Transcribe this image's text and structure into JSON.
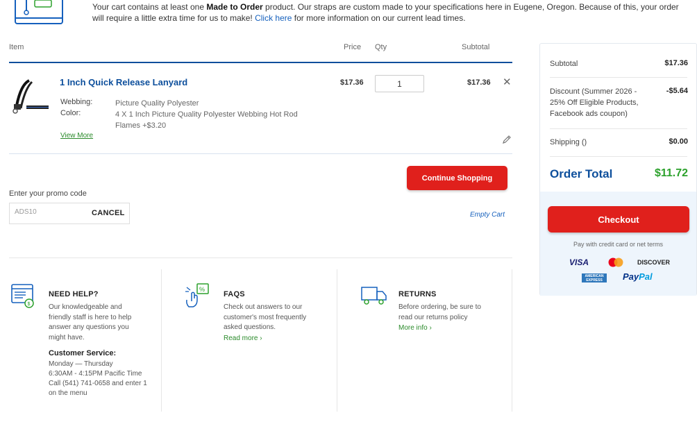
{
  "notice": {
    "text_pre": "Your cart contains at least one ",
    "text_bold": "Made to Order",
    "text_mid": " product. Our straps are custom made to your specifications here in Eugene, Oregon. Because of this, your order will require a little extra time for us to make! ",
    "link": "Click here",
    "text_post": " for more information on our current lead times."
  },
  "table_headers": {
    "item": "Item",
    "price": "Price",
    "qty": "Qty",
    "subtotal": "Subtotal"
  },
  "cart_item": {
    "name": "1 Inch Quick Release Lanyard",
    "options": [
      {
        "label": "Webbing:",
        "value": "Picture Quality Polyester"
      },
      {
        "label": "Color:",
        "value": "4 X 1 Inch Picture Quality Polyester Webbing Hot Rod Flames +$3.20"
      }
    ],
    "view_more": "View More",
    "price": "$17.36",
    "qty": "1",
    "subtotal": "$17.36"
  },
  "actions": {
    "continue_shopping": "Continue Shopping",
    "empty_cart": "Empty Cart"
  },
  "promo": {
    "label": "Enter your promo code",
    "value": "ADS10",
    "cancel": "CANCEL"
  },
  "help": {
    "need_help": {
      "title": "NEED HELP?",
      "text": "Our knowledgeable and friendly staff is here to help answer any questions you might have.",
      "cs_title": "Customer Service:",
      "cs_text_1": "Monday — Thursday",
      "cs_text_2": "6:30AM - 4:15PM Pacific Time",
      "cs_text_3": "Call (541) 741-0658 and enter 1 on the menu"
    },
    "faqs": {
      "title": "FAQS",
      "text": "Check out answers to our customer's most frequently asked questions.",
      "link": "Read more ›"
    },
    "returns": {
      "title": "RETURNS",
      "text": "Before ordering, be sure to read our returns policy",
      "link": "More info ›"
    }
  },
  "summary": {
    "subtotal_label": "Subtotal",
    "subtotal_value": "$17.36",
    "discount_label": "Discount (Summer 2026 - 25% Off Eligible Products, Facebook ads coupon)",
    "discount_value": "-$5.64",
    "shipping_label": "Shipping ()",
    "shipping_value": "$0.00",
    "total_label": "Order Total",
    "total_value": "$11.72",
    "checkout": "Checkout",
    "pay_note": "Pay with credit card or net terms",
    "cards": {
      "visa": "VISA",
      "discover": "DISCOVER",
      "amex": "AMERICAN EXPRESS",
      "paypal_1": "Pay",
      "paypal_2": "Pal"
    }
  },
  "colors": {
    "brand_blue": "#0d4f9c",
    "cta_red": "#e0201c",
    "success_green": "#2ca12c",
    "link_green": "#2a8a2a"
  }
}
